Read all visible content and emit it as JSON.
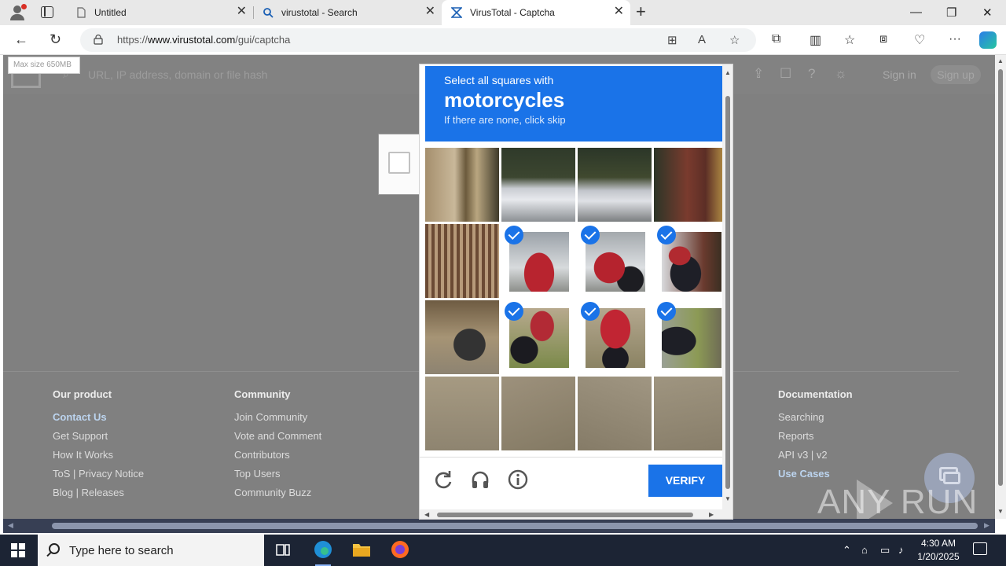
{
  "browser": {
    "tabs": [
      {
        "title": "Untitled",
        "active": false
      },
      {
        "title": "virustotal - Search",
        "active": false
      },
      {
        "title": "VirusTotal - Captcha",
        "active": true
      }
    ],
    "url_prefix": "https://",
    "url_domain": "www.virustotal.com",
    "url_path": "/gui/captcha"
  },
  "vt": {
    "search_placeholder": "URL, IP address, domain or file hash",
    "tooltip": "Max size 650MB",
    "signin_label": "Sign in",
    "signup_label": "Sign up"
  },
  "footer": {
    "col1": {
      "title": "Our product",
      "links": [
        "Contact Us",
        "Get Support",
        "How It Works",
        "ToS | Privacy Notice",
        "Blog | Releases"
      ]
    },
    "col2": {
      "title": "Community",
      "links": [
        "Join Community",
        "Vote and Comment",
        "Contributors",
        "Top Users",
        "Community Buzz"
      ]
    },
    "col3": {
      "title": "Documentation",
      "links": [
        "Searching",
        "Reports",
        "API v3 | v2",
        "Use Cases"
      ]
    }
  },
  "captcha": {
    "line1": "Select all squares with",
    "keyword": "motorcycles",
    "line3": "If there are none, click skip",
    "verify_label": "VERIFY",
    "accent_color": "#1a73e8",
    "selected_tiles": [
      5,
      6,
      7,
      9,
      10,
      11
    ]
  },
  "watermark": "ANY RUN",
  "taskbar": {
    "search_placeholder": "Type here to search",
    "time": "4:30 AM",
    "date": "1/20/2025"
  }
}
